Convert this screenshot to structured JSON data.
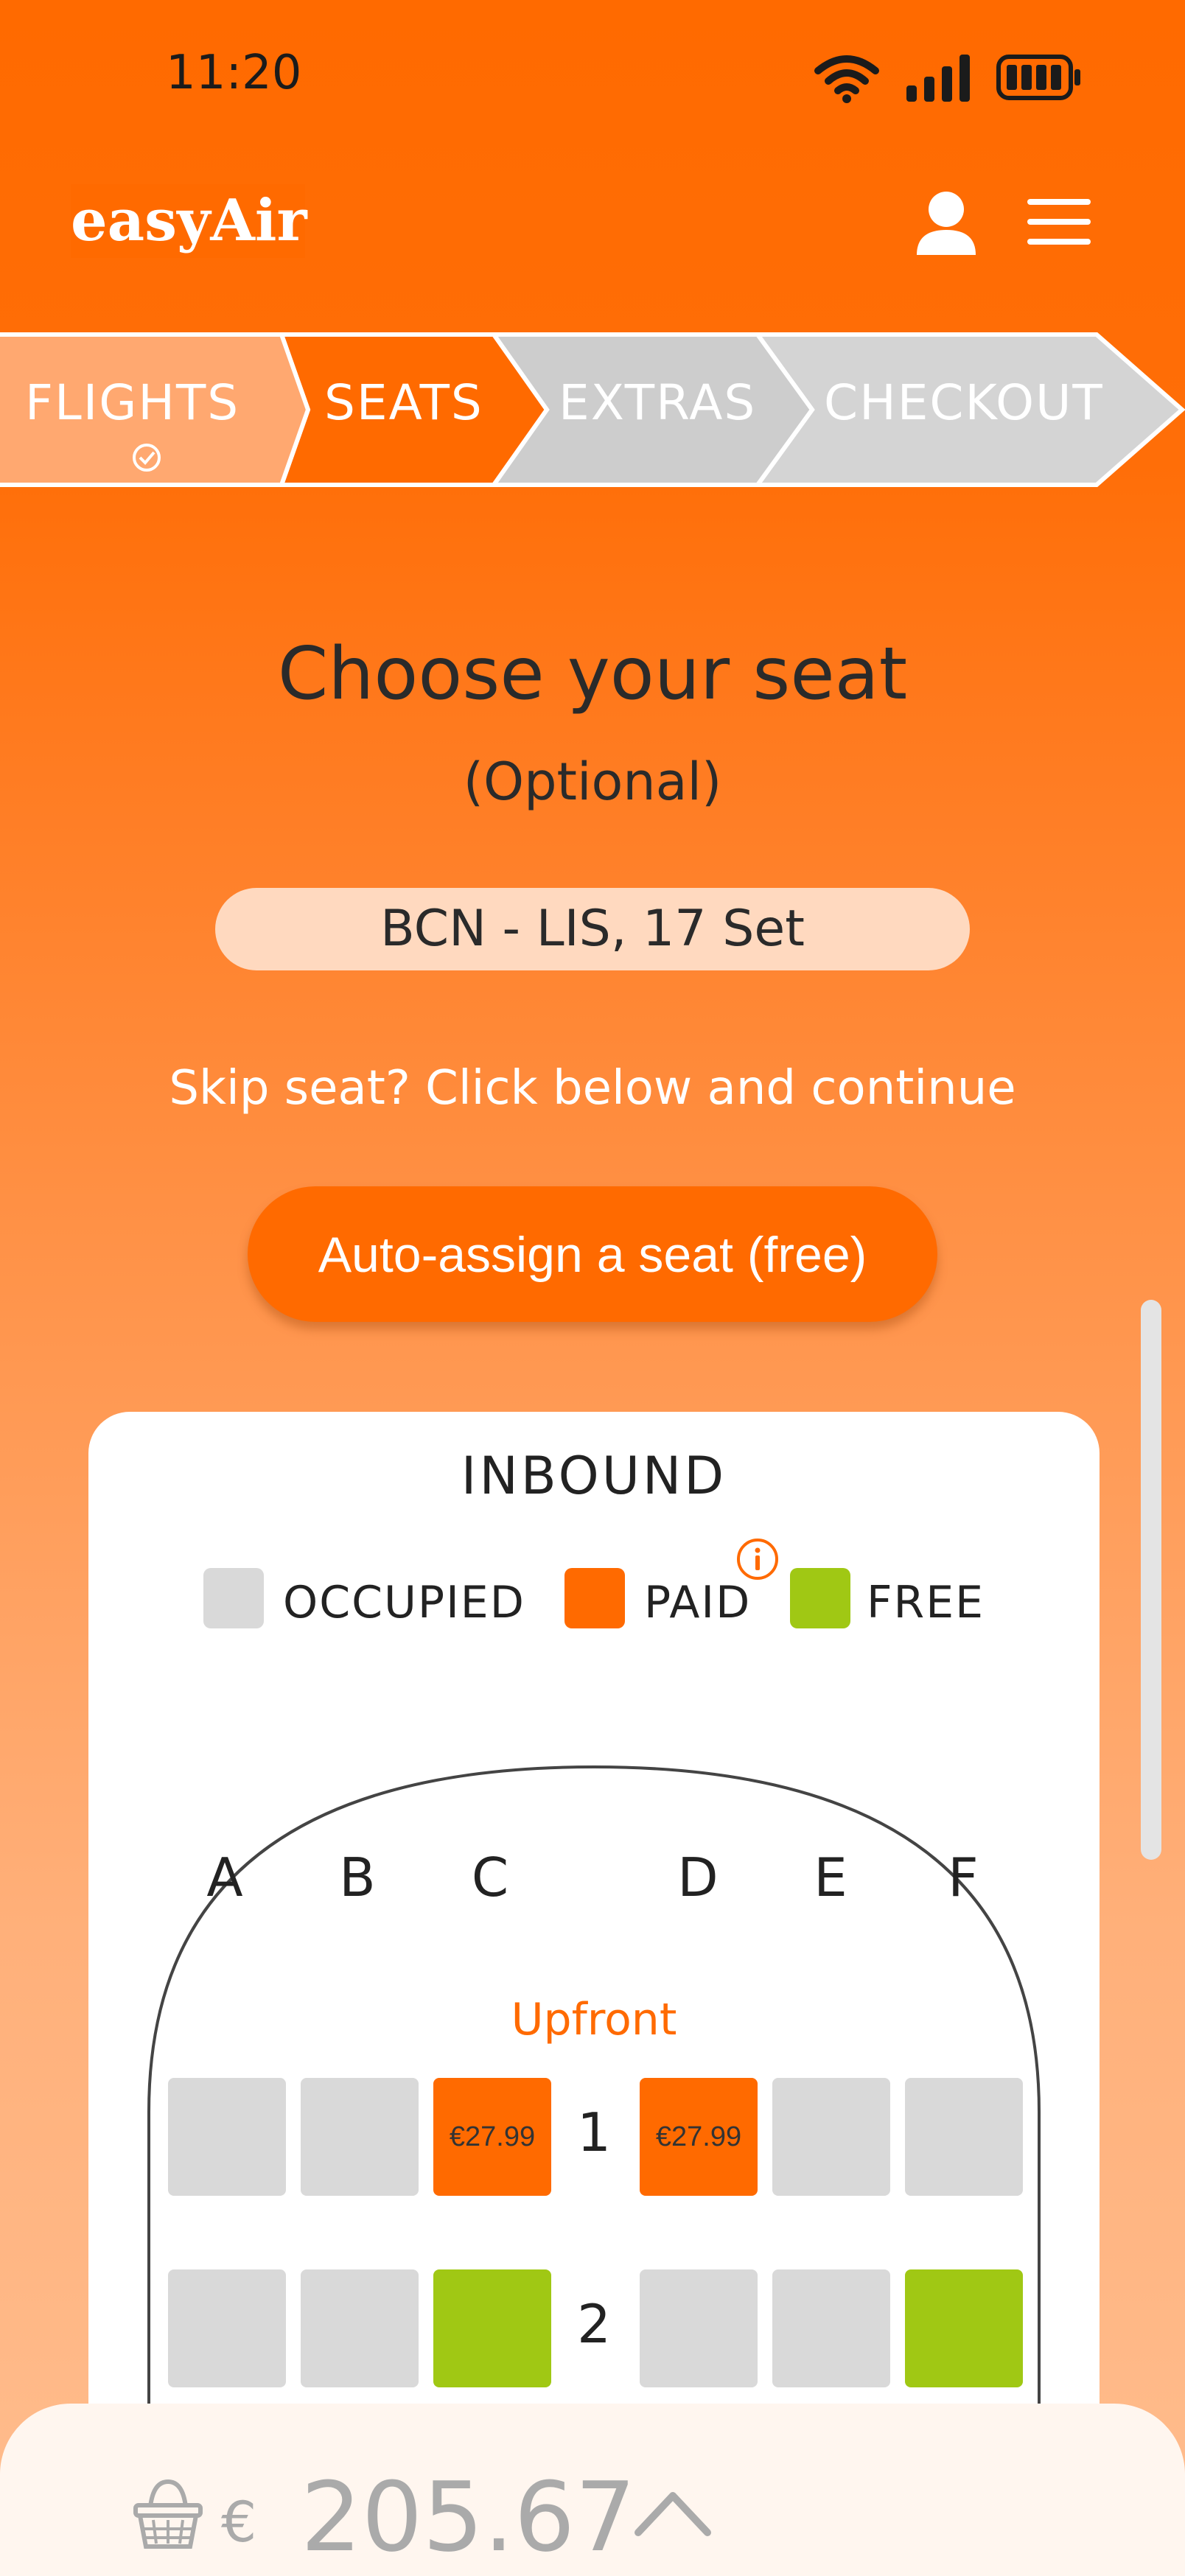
{
  "status_bar": {
    "time": "11:20"
  },
  "header": {
    "logo": "easyAir"
  },
  "stepper": {
    "steps": [
      {
        "label": "FLIGHTS",
        "state": "completed"
      },
      {
        "label": "SEATS",
        "state": "active"
      },
      {
        "label": "EXTRAS",
        "state": "upcoming"
      },
      {
        "label": "CHECKOUT",
        "state": "upcoming"
      }
    ]
  },
  "main": {
    "title": "Choose your seat",
    "subtitle": "(Optional)",
    "route": "BCN - LIS, 17 Set",
    "skip_text": "Skip seat? Click below and continue",
    "auto_assign_label": "Auto-assign a seat (free)"
  },
  "seatmap": {
    "direction": "INBOUND",
    "legend": {
      "occupied": "OCCUPIED",
      "paid": "PAID",
      "free": "FREE"
    },
    "columns": [
      "A",
      "B",
      "C",
      "D",
      "E",
      "F"
    ],
    "section_label": "Upfront",
    "rows": [
      {
        "number": "1",
        "seats": [
          {
            "col": "A",
            "status": "occupied",
            "price": ""
          },
          {
            "col": "B",
            "status": "occupied",
            "price": ""
          },
          {
            "col": "C",
            "status": "paid",
            "price": "€27.99"
          },
          {
            "col": "D",
            "status": "paid",
            "price": "€27.99"
          },
          {
            "col": "E",
            "status": "occupied",
            "price": ""
          },
          {
            "col": "F",
            "status": "occupied",
            "price": ""
          }
        ]
      },
      {
        "number": "2",
        "seats": [
          {
            "col": "A",
            "status": "occupied",
            "price": ""
          },
          {
            "col": "B",
            "status": "occupied",
            "price": ""
          },
          {
            "col": "C",
            "status": "free",
            "price": ""
          },
          {
            "col": "D",
            "status": "occupied",
            "price": ""
          },
          {
            "col": "E",
            "status": "occupied",
            "price": ""
          },
          {
            "col": "F",
            "status": "free",
            "price": ""
          }
        ]
      }
    ]
  },
  "basket": {
    "currency": "€",
    "total": "205.67"
  },
  "colors": {
    "brand": "#ff6a00",
    "free": "#a0c814",
    "occupied": "#d9d9d9",
    "pill": "#ffd9bf"
  }
}
